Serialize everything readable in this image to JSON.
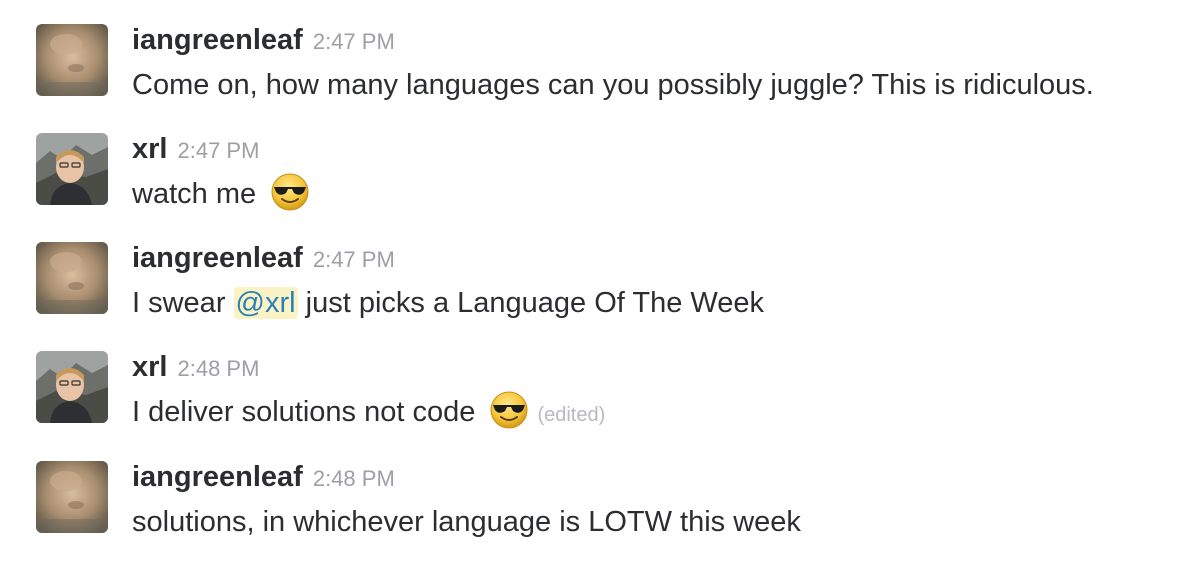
{
  "messages": [
    {
      "user": "iangreenleaf",
      "avatar": "avatar-iangreenleaf",
      "time": "2:47 PM",
      "text": "Come on, how many languages can you possibly juggle? This is ridiculous."
    },
    {
      "user": "xrl",
      "avatar": "avatar-xrl",
      "time": "2:47 PM",
      "text": "watch me",
      "emoji": "sunglasses-emoji"
    },
    {
      "user": "iangreenleaf",
      "avatar": "avatar-iangreenleaf",
      "time": "2:47 PM",
      "text_before": "I swear ",
      "mention": "@xrl",
      "text_after": " just picks a Language Of The Week"
    },
    {
      "user": "xrl",
      "avatar": "avatar-xrl",
      "time": "2:48 PM",
      "text": "I deliver solutions not code",
      "emoji": "sunglasses-emoji",
      "edited": "(edited)"
    },
    {
      "user": "iangreenleaf",
      "avatar": "avatar-iangreenleaf",
      "time": "2:48 PM",
      "text": "solutions, in whichever language is LOTW this week"
    }
  ],
  "colors": {
    "text": "#2c2d30",
    "timestamp": "#9e9ea6",
    "mention_bg": "#fcf3c4",
    "mention_text": "#2a80b9",
    "edited": "#b9b9bf"
  }
}
